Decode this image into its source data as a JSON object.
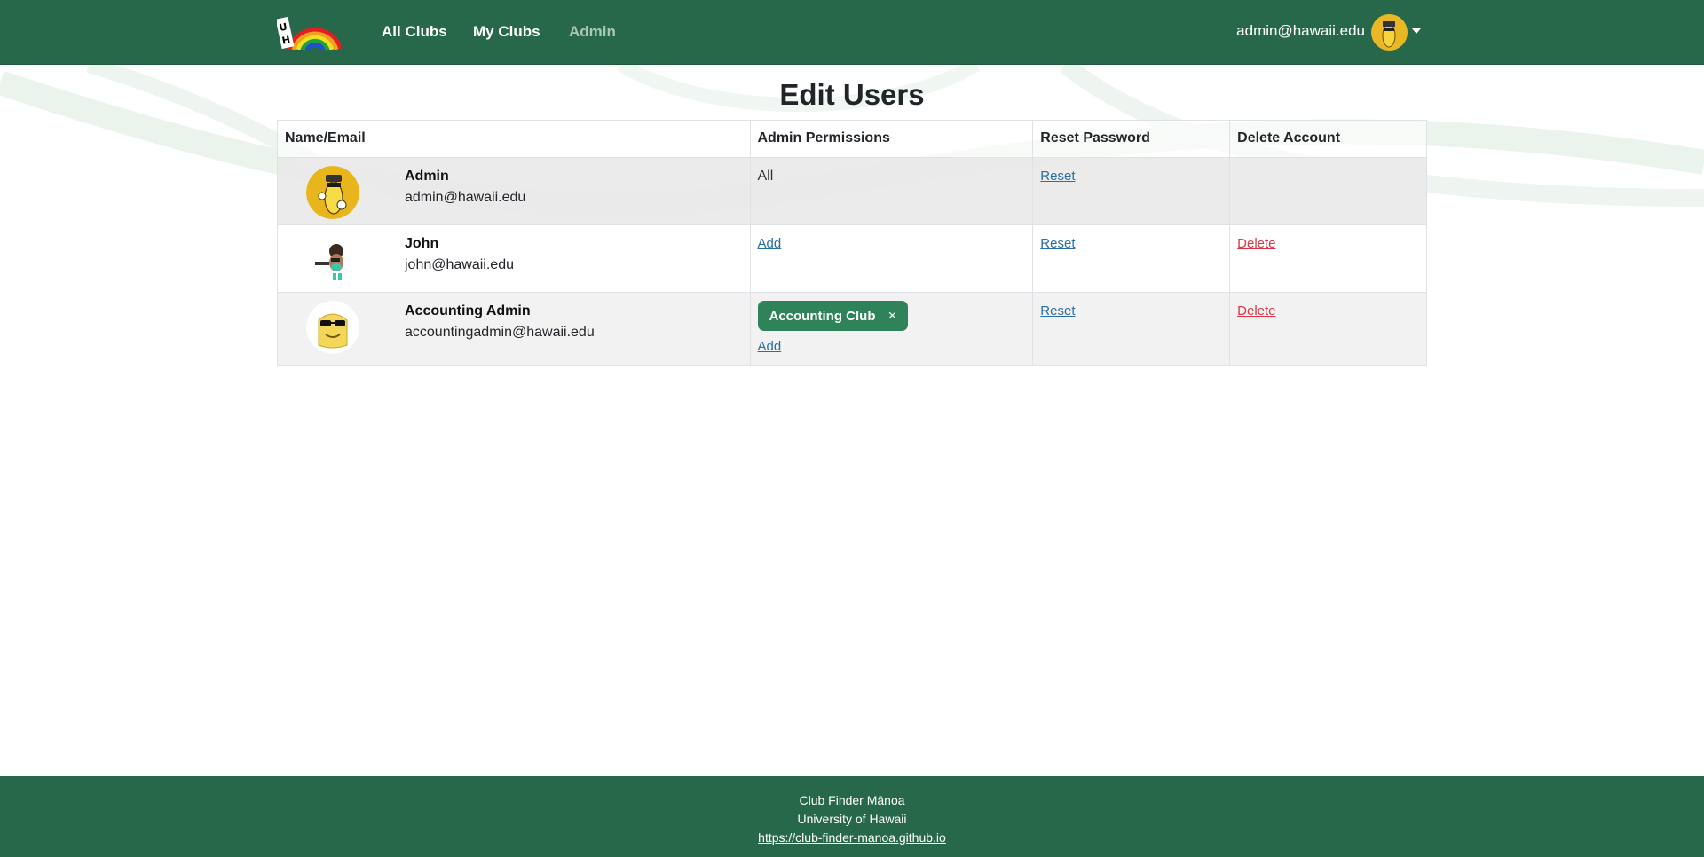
{
  "nav": {
    "logo_icon": "uh-rainbow-logo",
    "links": [
      "All Clubs",
      "My Clubs",
      "Admin"
    ],
    "user_email": "admin@hawaii.edu"
  },
  "page": {
    "title": "Edit Users"
  },
  "table": {
    "headers": [
      "Name/Email",
      "Admin Permissions",
      "Reset Password",
      "Delete Account"
    ],
    "rows": [
      {
        "name": "Admin",
        "email": "admin@hawaii.edu",
        "permission": "All",
        "reset": "Reset",
        "delete": ""
      },
      {
        "name": "John",
        "email": "john@hawaii.edu",
        "permission_add": "Add",
        "reset": "Reset",
        "delete": "Delete"
      },
      {
        "name": "Accounting Admin",
        "email": "accountingadmin@hawaii.edu",
        "chip": "Accounting Club",
        "chip_remove": "×",
        "permission_add": "Add",
        "reset": "Reset",
        "delete": "Delete"
      }
    ]
  },
  "footer": {
    "line1": "Club Finder Mānoa",
    "line2": "University of Hawaii",
    "link": "https://club-finder-manoa.github.io"
  },
  "colors": {
    "brand_green": "#28684a",
    "chip_green": "#2e8359",
    "link_blue": "#2a6fa1",
    "danger": "#dc3545"
  }
}
